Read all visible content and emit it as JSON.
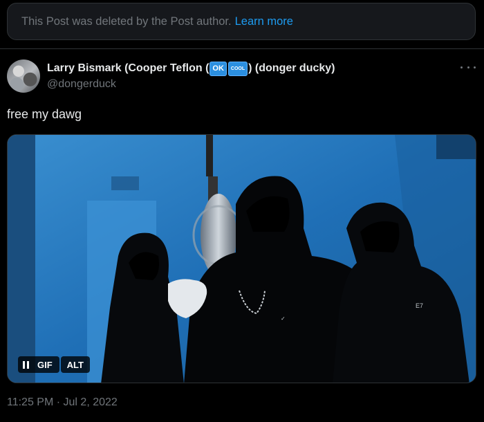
{
  "notice": {
    "text": "This Post was deleted by the Post author.",
    "link": "Learn more"
  },
  "post": {
    "display_name_prefix": "Larry Bismark (Cooper Teflon (",
    "emoji_ok": "OK",
    "emoji_cool": "COOL",
    "display_name_suffix": ") (donger ducky)",
    "handle": "@dongerduck",
    "text": "free my dawg",
    "media": {
      "badge_gif": "GIF",
      "badge_alt": "ALT"
    },
    "timestamp": "11:25 PM · Jul 2, 2022"
  },
  "icons": {
    "more": "more-dots-icon",
    "pause": "pause-icon"
  },
  "colors": {
    "background": "#000000",
    "link": "#1d9bf0",
    "muted": "#71767b",
    "text": "#e7e9ea"
  }
}
